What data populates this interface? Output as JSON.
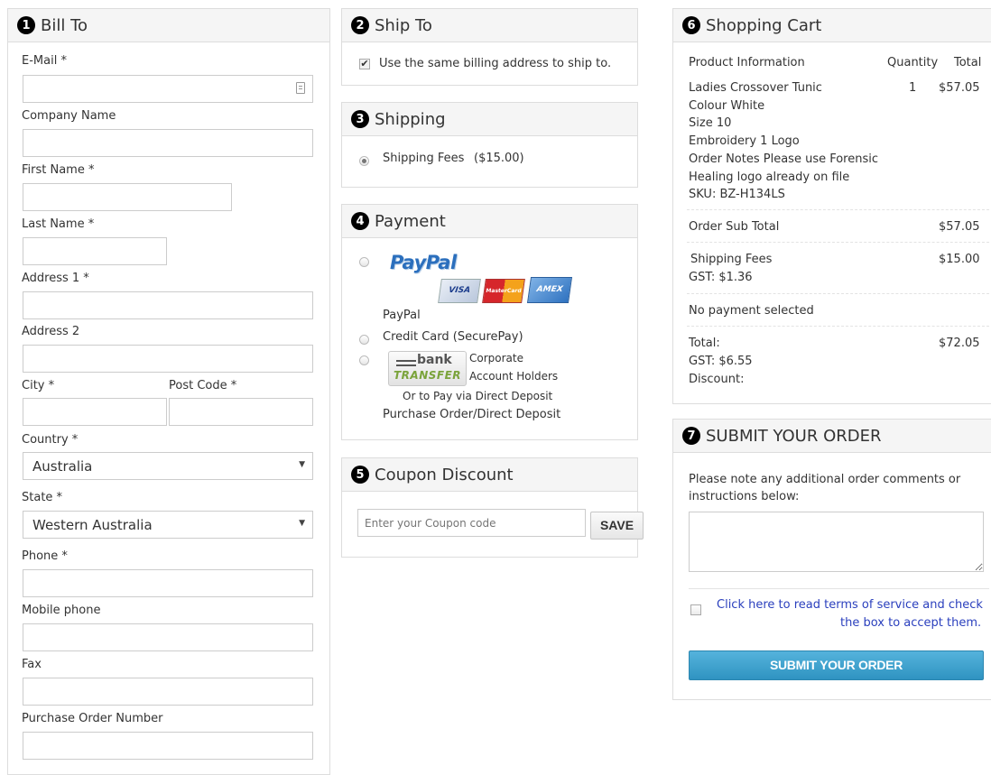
{
  "bill_to": {
    "number": "1",
    "title": "Bill To",
    "email_label": "E-Mail *",
    "company_label": "Company Name",
    "first_name_label": "First Name *",
    "last_name_label": "Last Name *",
    "address1_label": "Address 1 *",
    "address2_label": "Address 2",
    "city_label": "City *",
    "postcode_label": "Post Code *",
    "country_label": "Country *",
    "country_value": "Australia",
    "state_label": "State *",
    "state_value": "Western Australia",
    "phone_label": "Phone *",
    "mobile_label": "Mobile phone",
    "fax_label": "Fax",
    "po_label": "Purchase Order Number"
  },
  "ship_to": {
    "number": "2",
    "title": "Ship To",
    "same_address_label": "Use the same billing address to ship to.",
    "same_address_checked": true
  },
  "shipping": {
    "number": "3",
    "title": "Shipping",
    "option_label": "Shipping Fees",
    "option_price": "($15.00)"
  },
  "payment": {
    "number": "4",
    "title": "Payment",
    "paypal_logo": "PayPal",
    "paypal_label": "PayPal",
    "card_logos": [
      "VISA",
      "MasterCard",
      "AMEX"
    ],
    "credit_card_label": "Credit Card (SecurePay)",
    "bank_logo_top": "bank",
    "bank_logo_bottom": "TRANSFER",
    "bank_note_line1": "Corporate",
    "bank_note_line2": "Account Holders",
    "bank_note_line3": "Or to Pay via Direct Deposit",
    "bank_label": "Purchase Order/Direct Deposit"
  },
  "coupon": {
    "number": "5",
    "title": "Coupon Discount",
    "placeholder": "Enter your Coupon code",
    "save_label": "SAVE"
  },
  "cart": {
    "number": "6",
    "title": "Shopping Cart",
    "col_product": "Product Information",
    "col_quantity": "Quantity",
    "col_total": "Total",
    "item": {
      "name": "Ladies Crossover Tunic",
      "quantity": "1",
      "total": "$57.05",
      "details": [
        "Colour White",
        "Size 10",
        "Embroidery 1 Logo",
        "Order Notes Please use Forensic",
        "Healing logo already on file",
        "SKU: BZ-H134LS"
      ]
    },
    "subtotal_label": "Order Sub Total",
    "subtotal_value": "$57.05",
    "shipping_label": "Shipping Fees",
    "shipping_value": "$15.00",
    "shipping_gst": "GST: $1.36",
    "payment_status": "No payment selected",
    "total_label": "Total:",
    "total_value": "$72.05",
    "gst_label": "GST: $6.55",
    "discount_label": "Discount:"
  },
  "submit": {
    "number": "7",
    "title": "SUBMIT YOUR ORDER",
    "comments_note": "Please note any additional order comments or instructions below:",
    "terms_line1": "Click here to read terms of service and check",
    "terms_line2": "the box to accept them.",
    "button_label": "SUBMIT YOUR ORDER"
  },
  "colors": {
    "submit_button": "#3ea2cd",
    "link": "#2a3fbd",
    "panel_header": "#f5f5f5",
    "border": "#dddddd"
  }
}
